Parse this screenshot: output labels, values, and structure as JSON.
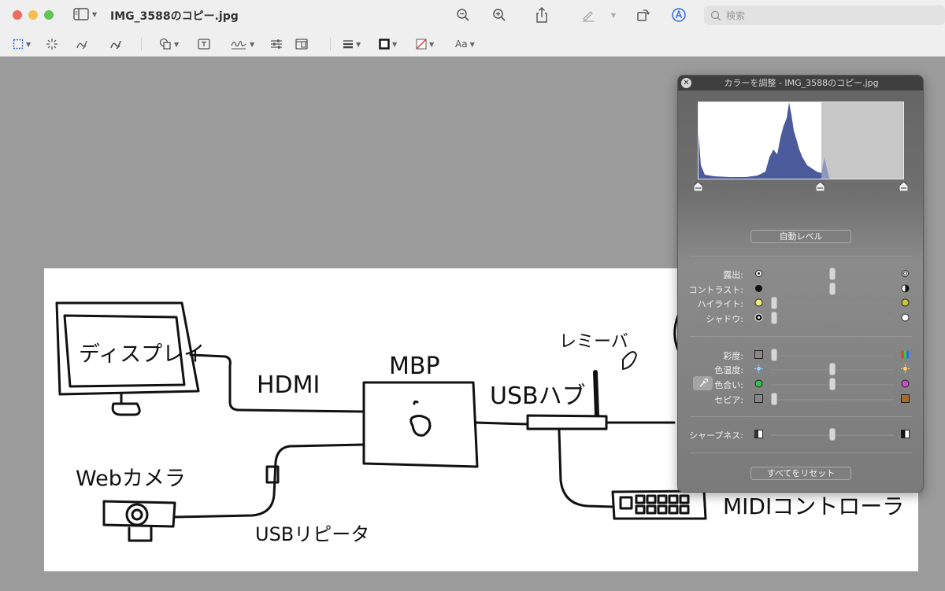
{
  "window": {
    "title": "IMG_3588のコピー.jpg",
    "search_placeholder": "検索"
  },
  "toolbar": {
    "icons": [
      "sidebar-icon",
      "zoom-out-icon",
      "zoom-in-icon",
      "share-icon",
      "markup-pen-icon",
      "rotate-icon",
      "markup-toolbar-icon",
      "search-icon"
    ]
  },
  "markup_toolbar": {
    "text_style_label": "Aa",
    "icons": [
      "rect-selection-icon",
      "instant-alpha-icon",
      "sketch-icon",
      "draw-icon",
      "shapes-icon",
      "text-box-icon",
      "signature-icon",
      "adjust-color-icon",
      "page-layout-icon",
      "shape-style-icon",
      "border-color-icon",
      "fill-color-icon"
    ]
  },
  "document": {
    "labels": {
      "display": "ディスプレイ",
      "hdmi": "HDMI",
      "mbp": "MBP",
      "usb_hub": "USBハブ",
      "lever": "レミーバ",
      "webcam": "Webカメラ",
      "usb_repeater": "USBリピータ",
      "midi": "MIDIコントローラ"
    }
  },
  "adjust_panel": {
    "title": "カラーを調整 - IMG_3588のコピー.jpg",
    "auto_levels": "自動レベル",
    "reset_all": "すべてをリセット",
    "sliders": [
      {
        "label": "露出:",
        "value": 0.5
      },
      {
        "label": "コントラスト:",
        "value": 0.5
      },
      {
        "label": "ハイライト:",
        "value": 0.0
      },
      {
        "label": "シャドウ:",
        "value": 0.0
      },
      {
        "label": "彩度:",
        "value": 0.0
      },
      {
        "label": "色温度:",
        "value": 0.5
      },
      {
        "label": "色合い:",
        "value": 0.5
      },
      {
        "label": "セピア:",
        "value": 0.0
      },
      {
        "label": "シャープネス:",
        "value": 0.5
      }
    ]
  }
}
